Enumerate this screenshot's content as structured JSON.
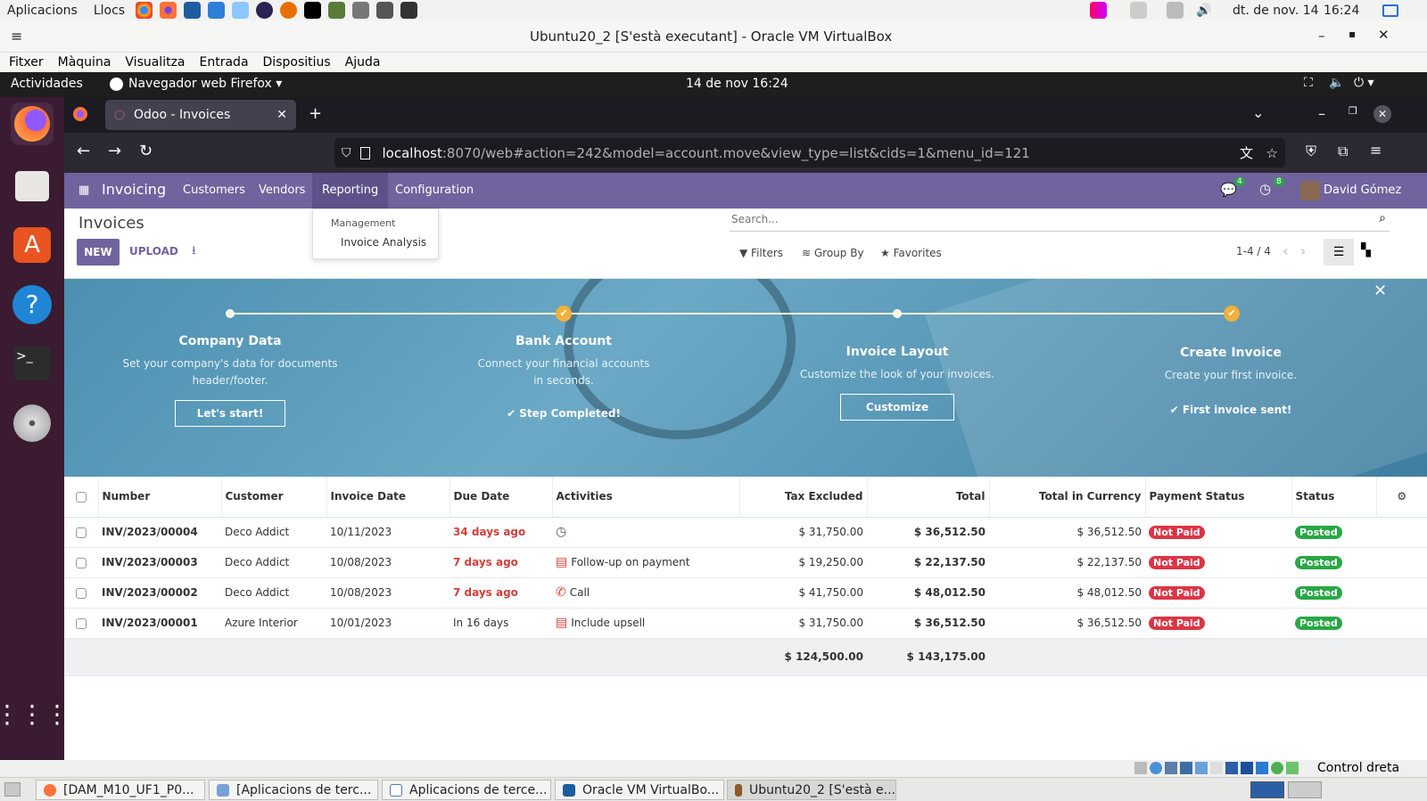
{
  "host_bar": {
    "apps": "Aplicacions",
    "places": "Llocs",
    "date": "dt. de nov. 14",
    "time": "16:24"
  },
  "vbox": {
    "title": "Ubuntu20_2 [S'està executant] - Oracle VM VirtualBox",
    "menu": [
      "Fitxer",
      "Màquina",
      "Visualitza",
      "Entrada",
      "Dispositius",
      "Ajuda"
    ]
  },
  "gnome": {
    "activities": "Actividades",
    "app": "Navegador web Firefox",
    "clock": "14 de nov  16:24"
  },
  "firefox": {
    "tab_title": "Odoo - Invoices",
    "url_host": "localhost",
    "url_rest": ":8070/web#action=242&model=account.move&view_type=list&cids=1&menu_id=121"
  },
  "odoo": {
    "app_name": "Invoicing",
    "menu": [
      "Customers",
      "Vendors",
      "Reporting",
      "Configuration"
    ],
    "messages_count": "4",
    "activities_count": "8",
    "user": "David Gómez",
    "dropdown": {
      "header": "Management",
      "item": "Invoice Analysis"
    },
    "breadcrumb": "Invoices",
    "new": "NEW",
    "upload": "UPLOAD",
    "search_placeholder": "Search...",
    "filters": "Filters",
    "group_by": "Group By",
    "favorites": "Favorites",
    "pager": "1-4 / 4"
  },
  "onboarding": [
    {
      "title": "Company Data",
      "desc": "Set your company's data for documents header/footer.",
      "button": "Let's start!",
      "done": false
    },
    {
      "title": "Bank Account",
      "desc": "Connect your financial accounts in seconds.",
      "done_text": "Step Completed!",
      "done": true
    },
    {
      "title": "Invoice Layout",
      "desc": "Customize the look of your invoices.",
      "button": "Customize",
      "done": false
    },
    {
      "title": "Create Invoice",
      "desc": "Create your first invoice.",
      "done_text": "First invoice sent!",
      "done": true
    }
  ],
  "table": {
    "headers": [
      "Number",
      "Customer",
      "Invoice Date",
      "Due Date",
      "Activities",
      "Tax Excluded",
      "Total",
      "Total in Currency",
      "Payment Status",
      "Status"
    ],
    "rows": [
      {
        "number": "INV/2023/00004",
        "customer": "Deco Addict",
        "date": "10/11/2023",
        "due": "34 days ago",
        "due_overdue": true,
        "activity": "",
        "activity_icon": "clock-icon",
        "tax_excl": "$ 31,750.00",
        "total": "$ 36,512.50",
        "total_cur": "$ 36,512.50",
        "payment": "Not Paid",
        "status": "Posted"
      },
      {
        "number": "INV/2023/00003",
        "customer": "Deco Addict",
        "date": "10/08/2023",
        "due": "7 days ago",
        "due_overdue": true,
        "activity": "Follow-up on payment",
        "activity_icon": "todo-icon",
        "tax_excl": "$ 19,250.00",
        "total": "$ 22,137.50",
        "total_cur": "$ 22,137.50",
        "payment": "Not Paid",
        "status": "Posted"
      },
      {
        "number": "INV/2023/00002",
        "customer": "Deco Addict",
        "date": "10/08/2023",
        "due": "7 days ago",
        "due_overdue": true,
        "activity": "Call",
        "activity_icon": "phone-icon",
        "tax_excl": "$ 41,750.00",
        "total": "$ 48,012.50",
        "total_cur": "$ 48,012.50",
        "payment": "Not Paid",
        "status": "Posted"
      },
      {
        "number": "INV/2023/00001",
        "customer": "Azure Interior",
        "date": "10/01/2023",
        "due": "In 16 days",
        "due_overdue": false,
        "activity": "Include upsell",
        "activity_icon": "todo-icon",
        "tax_excl": "$ 31,750.00",
        "total": "$ 36,512.50",
        "total_cur": "$ 36,512.50",
        "payment": "Not Paid",
        "status": "Posted"
      }
    ],
    "sum_tax_excl": "$ 124,500.00",
    "sum_total": "$ 143,175.00"
  },
  "statusbar": {
    "host_key": "Control dreta"
  },
  "taskbar": [
    "[DAM_M10_UF1_P0...",
    "[Aplicacions de terc...",
    "Aplicacions de terce...",
    "Oracle VM VirtualBo...",
    "Ubuntu20_2 [S'està e..."
  ],
  "colors": {
    "odoo_primary": "#71639e",
    "not_paid": "#dc3545",
    "posted": "#28a745",
    "overdue": "#d23f3a"
  }
}
